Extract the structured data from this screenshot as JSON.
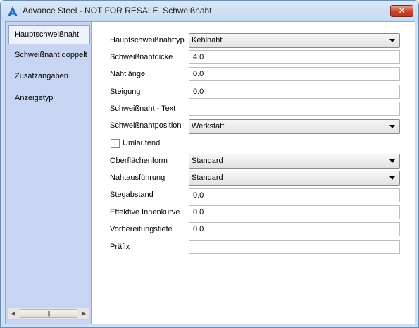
{
  "window": {
    "title": "Advance Steel - NOT FOR RESALE  Schweißnaht",
    "close_glyph": "✕",
    "accent": "#c8452b"
  },
  "sidebar": {
    "items": [
      {
        "label": "Hauptschweißnaht",
        "active": true
      },
      {
        "label": "Schweißnaht doppelt",
        "active": false
      },
      {
        "label": "Zusatzangaben",
        "active": false
      },
      {
        "label": "Anzeigetyp",
        "active": false
      }
    ],
    "scrollbar": {
      "left_arrow": "◀",
      "right_arrow": "▶",
      "thumb_grip": "|||"
    }
  },
  "form": {
    "hauptschweissnahttyp": {
      "label": "Hauptschweißnahttyp",
      "value": "Kehlnaht"
    },
    "schweissnahtdicke": {
      "label": "Schweißnahtdicke",
      "value": "4.0"
    },
    "nahtlaenge": {
      "label": "Nahtlänge",
      "value": "0.0"
    },
    "steigung": {
      "label": "Steigung",
      "value": "0.0"
    },
    "text": {
      "label": "Schweißnaht - Text",
      "value": ""
    },
    "position": {
      "label": "Schweißnahtposition",
      "value": "Werkstatt"
    },
    "umlaufend": {
      "label": "Umlaufend",
      "checked": false
    },
    "oberflaechenform": {
      "label": "Oberflächenform",
      "value": "Standard"
    },
    "nahtausfuehrung": {
      "label": "Nahtausführung",
      "value": "Standard"
    },
    "stegabstand": {
      "label": "Stegabstand",
      "value": "0.0"
    },
    "innenkurve": {
      "label": "Effektive Innenkurve",
      "value": "0.0"
    },
    "vorbereitungstiefe": {
      "label": "Vorbereitungstiefe",
      "value": "0.0"
    },
    "praefix": {
      "label": "Präfix",
      "value": ""
    }
  }
}
